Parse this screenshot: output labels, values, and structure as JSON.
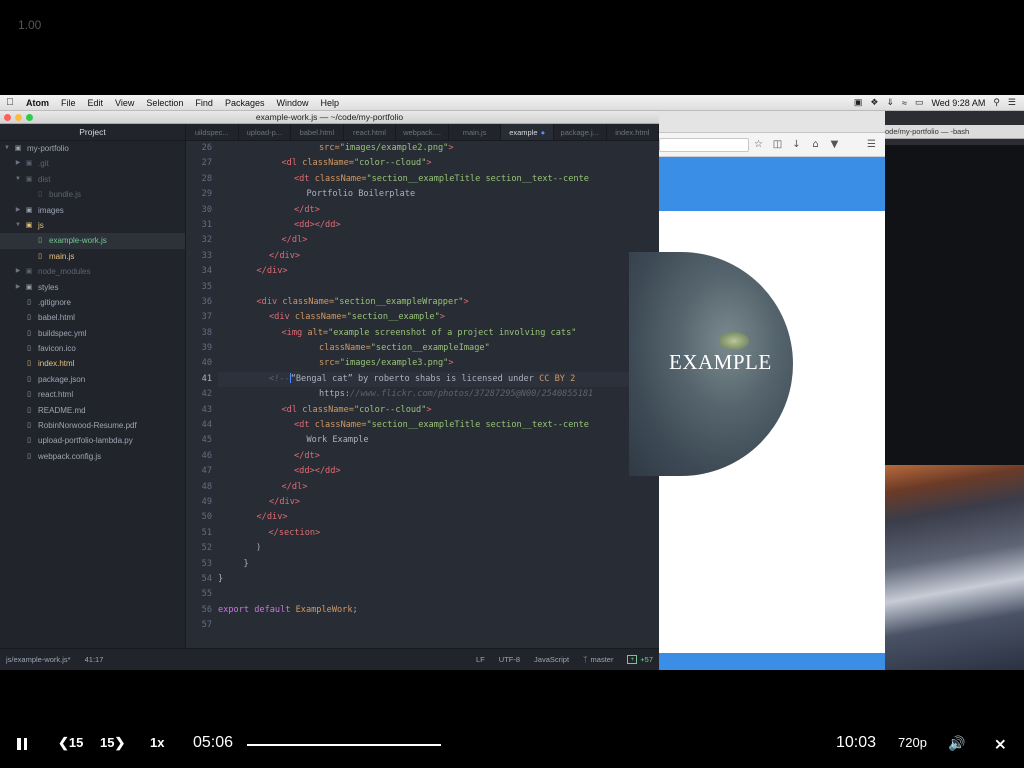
{
  "player": {
    "speed_indicator": "1.00",
    "back_label": "15",
    "forward_label": "15",
    "rate": "1x",
    "current_time": "05:06",
    "duration": "10:03",
    "quality": "720p",
    "progress_fraction": 0.51
  },
  "menubar": {
    "app": "Atom",
    "items": [
      "File",
      "Edit",
      "View",
      "Selection",
      "Find",
      "Packages",
      "Window",
      "Help"
    ],
    "clock": "Wed 9:28 AM"
  },
  "atom": {
    "window_title": "example-work.js — ~/code/my-portfolio",
    "sidebar_title": "Project",
    "tabs": [
      {
        "label": "uildspec...",
        "active": false
      },
      {
        "label": "upload-p...",
        "active": false
      },
      {
        "label": "babel.html",
        "active": false
      },
      {
        "label": "react.html",
        "active": false
      },
      {
        "label": "webpack....",
        "active": false
      },
      {
        "label": "main.js",
        "active": false
      },
      {
        "label": "example",
        "active": true,
        "modified": true
      },
      {
        "label": "package.j...",
        "active": false
      },
      {
        "label": "index.html",
        "active": false
      }
    ],
    "tree": [
      {
        "label": "my-portfolio",
        "depth": 0,
        "kind": "folder-open",
        "style": ""
      },
      {
        "label": ".git",
        "depth": 1,
        "kind": "folder",
        "style": "dim"
      },
      {
        "label": "dist",
        "depth": 1,
        "kind": "folder-open",
        "style": "dim"
      },
      {
        "label": "bundle.js",
        "depth": 2,
        "kind": "file",
        "style": "dim"
      },
      {
        "label": "images",
        "depth": 1,
        "kind": "folder",
        "style": ""
      },
      {
        "label": "js",
        "depth": 1,
        "kind": "folder-open",
        "style": "modified"
      },
      {
        "label": "example-work.js",
        "depth": 2,
        "kind": "file",
        "style": "added selected"
      },
      {
        "label": "main.js",
        "depth": 2,
        "kind": "file",
        "style": "modified"
      },
      {
        "label": "node_modules",
        "depth": 1,
        "kind": "folder",
        "style": "dim"
      },
      {
        "label": "styles",
        "depth": 1,
        "kind": "folder",
        "style": ""
      },
      {
        "label": ".gitignore",
        "depth": 1,
        "kind": "file",
        "style": ""
      },
      {
        "label": "babel.html",
        "depth": 1,
        "kind": "file",
        "style": ""
      },
      {
        "label": "buildspec.yml",
        "depth": 1,
        "kind": "file",
        "style": ""
      },
      {
        "label": "favicon.ico",
        "depth": 1,
        "kind": "file",
        "style": ""
      },
      {
        "label": "index.html",
        "depth": 1,
        "kind": "file",
        "style": "modified"
      },
      {
        "label": "package.json",
        "depth": 1,
        "kind": "file",
        "style": ""
      },
      {
        "label": "react.html",
        "depth": 1,
        "kind": "file",
        "style": ""
      },
      {
        "label": "README.md",
        "depth": 1,
        "kind": "file",
        "style": ""
      },
      {
        "label": "RobinNorwood-Resume.pdf",
        "depth": 1,
        "kind": "file",
        "style": ""
      },
      {
        "label": "upload-portfolio-lambda.py",
        "depth": 1,
        "kind": "file",
        "style": ""
      },
      {
        "label": "webpack.config.js",
        "depth": 1,
        "kind": "file",
        "style": ""
      }
    ],
    "code_lines": [
      {
        "n": 26,
        "indent": 6,
        "tokens": [
          [
            "a",
            "src="
          ],
          [
            "s",
            "\"images/example2.png\""
          ],
          [
            "t",
            ">"
          ]
        ]
      },
      {
        "n": 27,
        "indent": 3,
        "tokens": [
          [
            "t",
            "<dl "
          ],
          [
            "a",
            "className="
          ],
          [
            "s",
            "\"color--cloud\""
          ],
          [
            "t",
            ">"
          ]
        ]
      },
      {
        "n": 28,
        "indent": 4,
        "tokens": [
          [
            "t",
            "<dt "
          ],
          [
            "a",
            "className="
          ],
          [
            "s",
            "\"section__exampleTitle section__text--cente"
          ]
        ]
      },
      {
        "n": 29,
        "indent": 5,
        "tokens": [
          [
            "p",
            "Portfolio Boilerplate"
          ]
        ]
      },
      {
        "n": 30,
        "indent": 4,
        "tokens": [
          [
            "t",
            "</dt>"
          ]
        ]
      },
      {
        "n": 31,
        "indent": 4,
        "tokens": [
          [
            "t",
            "<dd></dd>"
          ]
        ]
      },
      {
        "n": 32,
        "indent": 3,
        "tokens": [
          [
            "t",
            "</dl>"
          ]
        ]
      },
      {
        "n": 33,
        "indent": 2,
        "tokens": [
          [
            "t",
            "</div>"
          ]
        ]
      },
      {
        "n": 34,
        "indent": 1,
        "tokens": [
          [
            "t",
            "</div>"
          ]
        ]
      },
      {
        "n": 35,
        "indent": 0,
        "tokens": []
      },
      {
        "n": 36,
        "indent": 1,
        "tokens": [
          [
            "t",
            "<div "
          ],
          [
            "a",
            "className="
          ],
          [
            "s",
            "\"section__exampleWrapper\""
          ],
          [
            "t",
            ">"
          ]
        ]
      },
      {
        "n": 37,
        "indent": 2,
        "tokens": [
          [
            "t",
            "<div "
          ],
          [
            "a",
            "className="
          ],
          [
            "s",
            "\"section__example\""
          ],
          [
            "t",
            ">"
          ]
        ]
      },
      {
        "n": 38,
        "indent": 3,
        "tokens": [
          [
            "t",
            "<img "
          ],
          [
            "a",
            "alt="
          ],
          [
            "s",
            "\"example screenshot of a project involving cats\""
          ]
        ]
      },
      {
        "n": 39,
        "indent": 6,
        "tokens": [
          [
            "a",
            "className="
          ],
          [
            "s",
            "\"section__exampleImage\""
          ]
        ]
      },
      {
        "n": 40,
        "indent": 6,
        "tokens": [
          [
            "a",
            "src="
          ],
          [
            "s",
            "\"images/example3.png\""
          ],
          [
            "t",
            ">"
          ]
        ]
      },
      {
        "n": 41,
        "indent": 2,
        "current": true,
        "tokens": [
          [
            "c",
            "<!--"
          ],
          [
            "cursor",
            ""
          ],
          [
            "p",
            "“Bengal cat” by roberto shabs is licensed under "
          ],
          [
            "o",
            "CC BY 2"
          ]
        ]
      },
      {
        "n": 42,
        "indent": 6,
        "tokens": [
          [
            "p",
            "https:"
          ],
          [
            "c",
            "//www.flickr.com/photos/37287295@N00/2540855181"
          ]
        ]
      },
      {
        "n": 43,
        "indent": 3,
        "tokens": [
          [
            "t",
            "<dl "
          ],
          [
            "a",
            "className="
          ],
          [
            "s",
            "\"color--cloud\""
          ],
          [
            "t",
            ">"
          ]
        ]
      },
      {
        "n": 44,
        "indent": 4,
        "tokens": [
          [
            "t",
            "<dt "
          ],
          [
            "a",
            "className="
          ],
          [
            "s",
            "\"section__exampleTitle section__text--cente"
          ]
        ]
      },
      {
        "n": 45,
        "indent": 5,
        "tokens": [
          [
            "p",
            "Work Example"
          ]
        ]
      },
      {
        "n": 46,
        "indent": 4,
        "tokens": [
          [
            "t",
            "</dt>"
          ]
        ]
      },
      {
        "n": 47,
        "indent": 4,
        "tokens": [
          [
            "t",
            "<dd></dd>"
          ]
        ]
      },
      {
        "n": 48,
        "indent": 3,
        "tokens": [
          [
            "t",
            "</dl>"
          ]
        ]
      },
      {
        "n": 49,
        "indent": 2,
        "tokens": [
          [
            "t",
            "</div>"
          ]
        ]
      },
      {
        "n": 50,
        "indent": 1,
        "tokens": [
          [
            "t",
            "</div>"
          ]
        ]
      },
      {
        "n": 51,
        "indent": 1,
        "sub": 1,
        "tokens": [
          [
            "t",
            "</section>"
          ]
        ]
      },
      {
        "n": 52,
        "indent": 1,
        "sub": 2,
        "tokens": [
          [
            "p",
            ")"
          ]
        ]
      },
      {
        "n": 53,
        "indent": 1,
        "sub": 3,
        "tokens": [
          [
            "p",
            "}"
          ]
        ]
      },
      {
        "n": 54,
        "indent": 0,
        "tokens": [
          [
            "p",
            "}"
          ]
        ]
      },
      {
        "n": 55,
        "indent": 0,
        "tokens": []
      },
      {
        "n": 56,
        "indent": 0,
        "tokens": [
          [
            "k",
            "export default "
          ],
          [
            "o",
            "ExampleWork"
          ],
          [
            "p",
            ";"
          ]
        ]
      },
      {
        "n": 57,
        "indent": 0,
        "tokens": []
      }
    ],
    "status": {
      "file": "js/example-work.js*",
      "position": "41:17",
      "line_ending": "LF",
      "encoding": "UTF-8",
      "grammar": "JavaScript",
      "branch": "master",
      "diff": "+57"
    }
  },
  "browser": {
    "hero_title": "EXAMPLE"
  },
  "terminal": {
    "title": "ode/my-portfolio — -bash"
  },
  "colors": {
    "tag": "#e06c75",
    "attr": "#d19a66",
    "string": "#98c379",
    "keyword": "#c678dd",
    "comment": "#5c6370",
    "plain": "#abb2bf",
    "orange": "#d19a66",
    "brand_blue": "#3a8ee6"
  }
}
